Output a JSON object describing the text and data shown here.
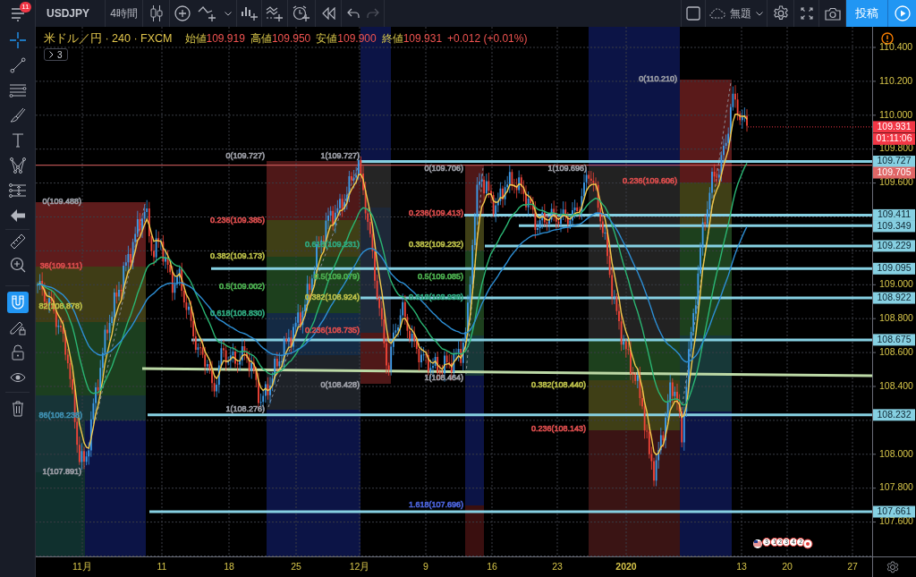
{
  "top_bar": {
    "notification_count": "11",
    "symbol": "USDJPY",
    "interval": "4時間",
    "layout_name": "無題",
    "publish": "投稿"
  },
  "left_toolbar": {
    "crosshair_active": true,
    "magnet_on": true
  },
  "legend": {
    "title": "米ドル／円 · 240 · FXCM",
    "values": [
      {
        "label": "始値",
        "value": "109.919"
      },
      {
        "label": "高値",
        "value": "109.950"
      },
      {
        "label": "安値",
        "value": "109.900"
      },
      {
        "label": "終値",
        "value": "109.931"
      }
    ],
    "change": "+0.012 (+0.01%)",
    "hidden_indicators": "3"
  },
  "fib_labels": [
    {
      "text": "0(110.210)",
      "color": "#9a9ca4"
    },
    {
      "text": "0(109.727)",
      "color": "#9a9ca4"
    },
    {
      "text": "1(109.727)",
      "color": "#9a9ca4"
    },
    {
      "text": "0(109.706)",
      "color": "#9a9ca4"
    },
    {
      "text": "1(109.696)",
      "color": "#9a9ca4"
    },
    {
      "text": "0.236(109.606)",
      "color": "#d84c4c"
    },
    {
      "text": "0(109.488)",
      "color": "#9a9ca4"
    },
    {
      "text": "0.236(109.413)",
      "color": "#d84c4c"
    },
    {
      "text": "0.236(109.385)",
      "color": "#d84c4c"
    },
    {
      "text": "0.618(109.231)",
      "color": "#2fa77e"
    },
    {
      "text": "0.382(109.232)",
      "color": "#b8bc48"
    },
    {
      "text": "0.382(109.173)",
      "color": "#b8bc48"
    },
    {
      "text": "36(109.111)",
      "color": "#d84c4c"
    },
    {
      "text": "0.5(109.079)",
      "color": "#4caf50"
    },
    {
      "text": "0.5(109.085)",
      "color": "#4caf50"
    },
    {
      "text": "0.5(109.002)",
      "color": "#4caf50"
    },
    {
      "text": "0.382(108.924)",
      "color": "#b8bc48"
    },
    {
      "text": "0.618(108.938)",
      "color": "#2fa77e"
    },
    {
      "text": "82(108.878)",
      "color": "#b8bc48"
    },
    {
      "text": "0.618(108.830)",
      "color": "#2fa77e"
    },
    {
      "text": "0.236(108.735)",
      "color": "#d84c4c"
    },
    {
      "text": "1(108.464)",
      "color": "#9a9ca4"
    },
    {
      "text": "0(108.428)",
      "color": "#9a9ca4"
    },
    {
      "text": "0.382(108.440)",
      "color": "#b8bc48"
    },
    {
      "text": "1(108.276)",
      "color": "#9a9ca4"
    },
    {
      "text": "86(108.238)",
      "color": "#3f8fb0"
    },
    {
      "text": "0.236(108.143)",
      "color": "#d84c4c"
    },
    {
      "text": "1(107.891)",
      "color": "#9a9ca4"
    },
    {
      "text": "1.618(107.696)",
      "color": "#4a62d8"
    }
  ],
  "price_axis": [
    "110.400",
    "110.200",
    "110.000",
    "109.800",
    "109.600",
    "109.000",
    "108.800",
    "108.600",
    "108.400",
    "108.000",
    "107.800",
    "107.600"
  ],
  "price_tags": [
    {
      "text": "109.931",
      "kind": "last_price",
      "color": "#f23645"
    },
    {
      "text": "01:11:06",
      "kind": "countdown",
      "color": "#f23645"
    },
    {
      "text": "109.727",
      "kind": "horizontal_line",
      "color": "#86d0e2"
    },
    {
      "text": "109.705",
      "kind": "reference_line",
      "color": "#e06666"
    },
    {
      "text": "109.411",
      "kind": "horizontal_line",
      "color": "#86d0e2"
    },
    {
      "text": "109.349",
      "kind": "horizontal_line",
      "color": "#86d0e2"
    },
    {
      "text": "109.229",
      "kind": "horizontal_line",
      "color": "#86d0e2"
    },
    {
      "text": "109.095",
      "kind": "horizontal_line",
      "color": "#86d0e2"
    },
    {
      "text": "108.922",
      "kind": "horizontal_line",
      "color": "#86d0e2"
    },
    {
      "text": "108.675",
      "kind": "horizontal_line",
      "color": "#86d0e2"
    },
    {
      "text": "108.232",
      "kind": "horizontal_line",
      "color": "#86d0e2"
    },
    {
      "text": "107.661",
      "kind": "horizontal_line",
      "color": "#86d0e2"
    }
  ],
  "time_axis": [
    {
      "label": "11月",
      "emphasized": false
    },
    {
      "label": "11",
      "emphasized": false
    },
    {
      "label": "18",
      "emphasized": false
    },
    {
      "label": "25",
      "emphasized": false
    },
    {
      "label": "12月",
      "emphasized": false
    },
    {
      "label": "9",
      "emphasized": false
    },
    {
      "label": "16",
      "emphasized": false
    },
    {
      "label": "23",
      "emphasized": false
    },
    {
      "label": "2020",
      "emphasized": true
    },
    {
      "label": "13",
      "emphasized": false
    },
    {
      "label": "20",
      "emphasized": false
    },
    {
      "label": "27",
      "emphasized": false
    }
  ],
  "events": [
    "3",
    "1",
    "2",
    "3",
    "4",
    "2"
  ]
}
